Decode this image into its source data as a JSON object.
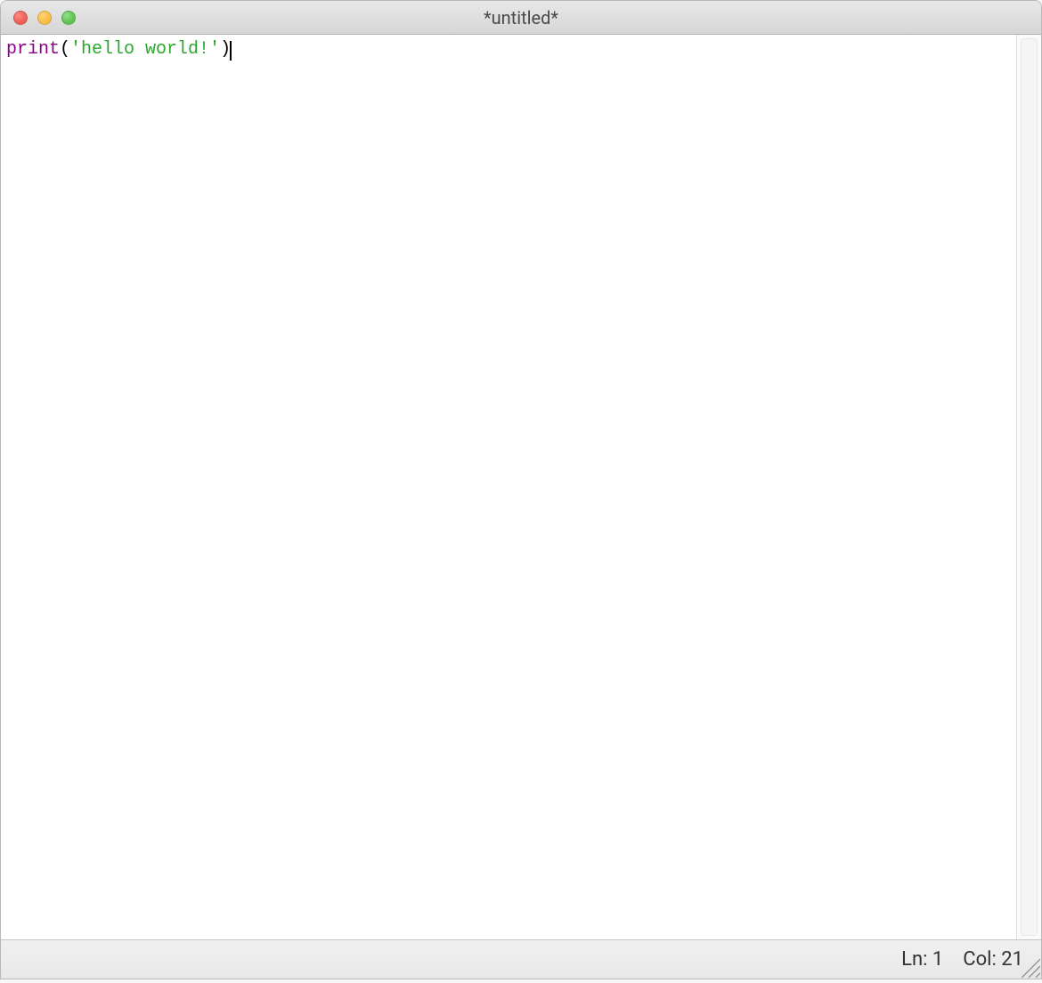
{
  "window": {
    "title": "*untitled*"
  },
  "editor": {
    "tokens": [
      {
        "cls": "tok-keyword",
        "text": "print"
      },
      {
        "cls": "tok-paren",
        "text": "("
      },
      {
        "cls": "tok-string",
        "text": "'hello world!'"
      },
      {
        "cls": "tok-paren",
        "text": ")"
      }
    ]
  },
  "status": {
    "line_label": "Ln: 1",
    "col_label": "Col: 21"
  }
}
